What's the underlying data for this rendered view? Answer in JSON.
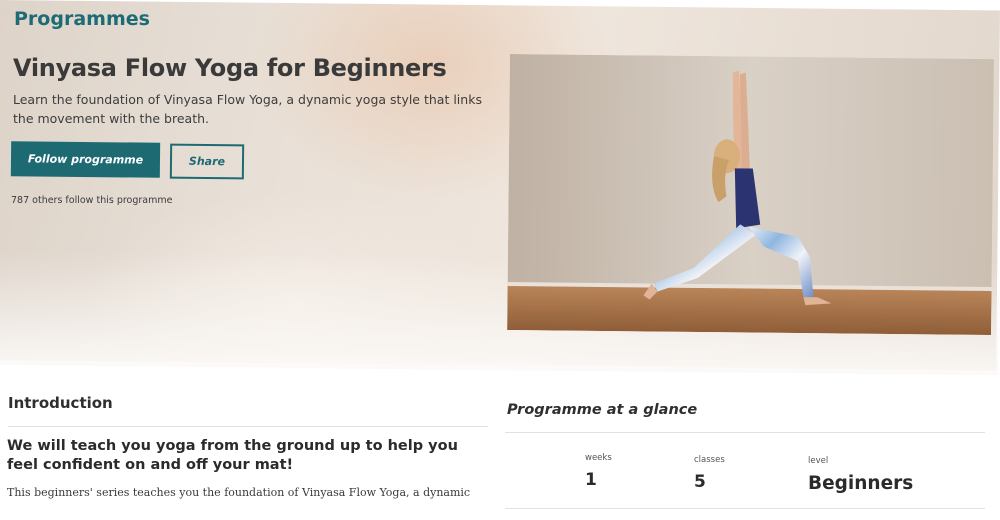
{
  "header": {
    "section_label": "Programmes"
  },
  "programme": {
    "title": "Vinyasa Flow Yoga for Beginners",
    "description": "Learn the foundation of Vinyasa Flow Yoga, a dynamic yoga style that links the movement with the breath.",
    "follow_button": "Follow programme",
    "share_button": "Share",
    "followers_text": "787 others follow this programme"
  },
  "introduction": {
    "heading": "Introduction",
    "lead": "We will teach you yoga from the ground up to help you feel confident on and off your mat!",
    "body": "This beginners' series teaches you the foundation of Vinyasa Flow Yoga, a dynamic"
  },
  "glance": {
    "heading": "Programme at a glance",
    "stats": [
      {
        "label": "weeks",
        "value": "1"
      },
      {
        "label": "classes",
        "value": "5"
      },
      {
        "label": "level",
        "value": "Beginners"
      }
    ]
  },
  "colors": {
    "accent": "#1e6a72",
    "heading_teal": "#1d6b74"
  }
}
